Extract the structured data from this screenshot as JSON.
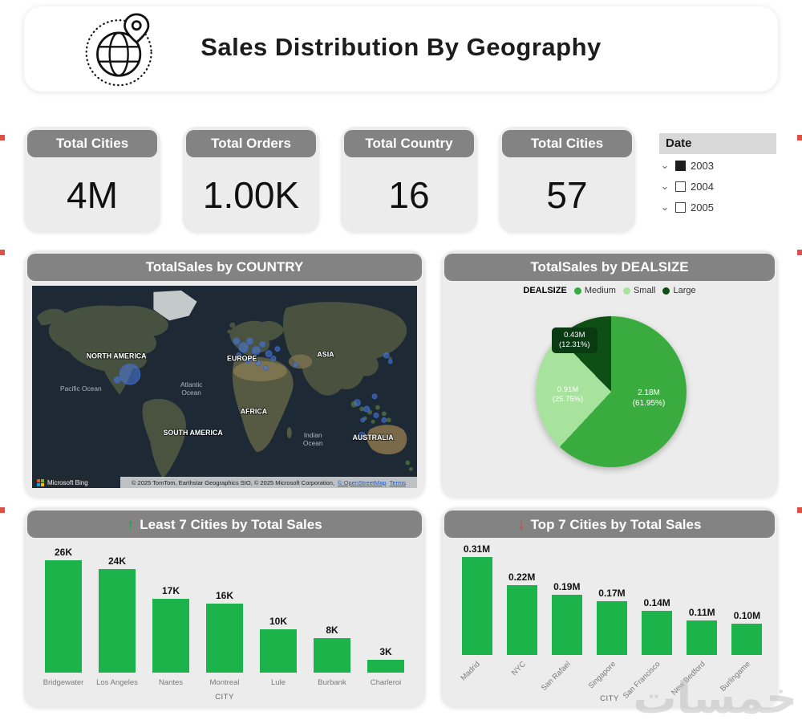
{
  "header": {
    "title": "Sales Distribution By Geography"
  },
  "kpis": [
    {
      "label": "Total Cities",
      "value": "4M"
    },
    {
      "label": "Total Orders",
      "value": "1.00K"
    },
    {
      "label": "Total Country",
      "value": "16"
    },
    {
      "label": "Total Cities",
      "value": "57"
    }
  ],
  "date_slicer": {
    "title": "Date",
    "options": [
      {
        "label": "2003",
        "checked": true
      },
      {
        "label": "2004",
        "checked": false
      },
      {
        "label": "2005",
        "checked": false
      }
    ]
  },
  "map_panel": {
    "title": "TotalSales by COUNTRY",
    "region_labels": {
      "north_america": "NORTH AMERICA",
      "europe": "EUROPE",
      "asia": "ASIA",
      "africa": "AFRICA",
      "south_america": "SOUTH AMERICA",
      "australia": "AUSTRALIA",
      "pacific": "Pacific Ocean",
      "atlantic_1": "Atlantic",
      "atlantic_2": "Ocean",
      "indian_1": "Indian",
      "indian_2": "Ocean"
    },
    "provider": "Microsoft Bing",
    "attribution": "© 2025 TomTom, Earthstar Geographics SIO, © 2025 Microsoft Corporation,",
    "osm_link": "© OpenStreetMap",
    "terms_link": "Terms"
  },
  "pie_panel": {
    "title": "TotalSales by DEALSIZE",
    "legend_title": "DEALSIZE"
  },
  "least_panel": {
    "title": "Least 7 Cities by Total Sales",
    "arrow": "↑"
  },
  "top_panel": {
    "title": "Top 7 Cities by Total Sales",
    "arrow": "↓"
  },
  "watermark": "خمسات",
  "colors": {
    "bar_green": "#1cb44a",
    "pie_medium": "#3aac3f",
    "pie_small": "#a8e39d",
    "pie_large": "#0d4f14",
    "band_gray": "#838383"
  },
  "chart_data": [
    {
      "type": "pie",
      "title": "TotalSales by DEALSIZE",
      "legend_position": "top",
      "slices": [
        {
          "name": "Medium",
          "value": 2.18,
          "unit": "M",
          "percent": 61.95,
          "line1": "2.18M",
          "line2": "(61.95%)",
          "color": "#3aac3f"
        },
        {
          "name": "Small",
          "value": 0.91,
          "unit": "M",
          "percent": 25.75,
          "line1": "0.91M",
          "line2": "(25.75%)",
          "color": "#a8e39d"
        },
        {
          "name": "Large",
          "value": 0.43,
          "unit": "M",
          "percent": 12.31,
          "line1": "0.43M",
          "line2": "(12.31%)",
          "color": "#0d4f14"
        }
      ]
    },
    {
      "type": "bar",
      "title": "Least 7 Cities by Total Sales",
      "xlabel": "CITY",
      "categories": [
        "Bridgewater",
        "Los Angeles",
        "Nantes",
        "Montreal",
        "Lule",
        "Burbank",
        "Charleroi"
      ],
      "values": [
        26,
        24,
        17,
        16,
        10,
        8,
        3
      ],
      "value_labels": [
        "26K",
        "24K",
        "17K",
        "16K",
        "10K",
        "8K",
        "3K"
      ],
      "unit": "K",
      "bar_color": "#1cb44a"
    },
    {
      "type": "bar",
      "title": "Top 7 Cities by Total Sales",
      "xlabel": "CITY",
      "categories": [
        "Madrid",
        "NYC",
        "San Rafael",
        "Singapore",
        "San Francisco",
        "New Bedford",
        "Burlingame"
      ],
      "values": [
        0.31,
        0.22,
        0.19,
        0.17,
        0.14,
        0.11,
        0.1
      ],
      "value_labels": [
        "0.31M",
        "0.22M",
        "0.19M",
        "0.17M",
        "0.14M",
        "0.11M",
        "0.10M"
      ],
      "unit": "M",
      "bar_color": "#1cb44a"
    }
  ]
}
